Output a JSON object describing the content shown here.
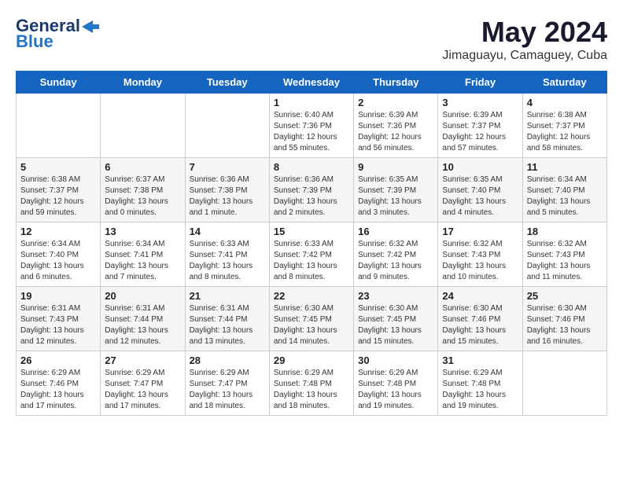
{
  "header": {
    "logo_general": "General",
    "logo_blue": "Blue",
    "month_title": "May 2024",
    "location": "Jimaguayu, Camaguey, Cuba"
  },
  "weekdays": [
    "Sunday",
    "Monday",
    "Tuesday",
    "Wednesday",
    "Thursday",
    "Friday",
    "Saturday"
  ],
  "weeks": [
    [
      {
        "day": "",
        "info": ""
      },
      {
        "day": "",
        "info": ""
      },
      {
        "day": "",
        "info": ""
      },
      {
        "day": "1",
        "info": "Sunrise: 6:40 AM\nSunset: 7:36 PM\nDaylight: 12 hours\nand 55 minutes."
      },
      {
        "day": "2",
        "info": "Sunrise: 6:39 AM\nSunset: 7:36 PM\nDaylight: 12 hours\nand 56 minutes."
      },
      {
        "day": "3",
        "info": "Sunrise: 6:39 AM\nSunset: 7:37 PM\nDaylight: 12 hours\nand 57 minutes."
      },
      {
        "day": "4",
        "info": "Sunrise: 6:38 AM\nSunset: 7:37 PM\nDaylight: 12 hours\nand 58 minutes."
      }
    ],
    [
      {
        "day": "5",
        "info": "Sunrise: 6:38 AM\nSunset: 7:37 PM\nDaylight: 12 hours\nand 59 minutes."
      },
      {
        "day": "6",
        "info": "Sunrise: 6:37 AM\nSunset: 7:38 PM\nDaylight: 13 hours\nand 0 minutes."
      },
      {
        "day": "7",
        "info": "Sunrise: 6:36 AM\nSunset: 7:38 PM\nDaylight: 13 hours\nand 1 minute."
      },
      {
        "day": "8",
        "info": "Sunrise: 6:36 AM\nSunset: 7:39 PM\nDaylight: 13 hours\nand 2 minutes."
      },
      {
        "day": "9",
        "info": "Sunrise: 6:35 AM\nSunset: 7:39 PM\nDaylight: 13 hours\nand 3 minutes."
      },
      {
        "day": "10",
        "info": "Sunrise: 6:35 AM\nSunset: 7:40 PM\nDaylight: 13 hours\nand 4 minutes."
      },
      {
        "day": "11",
        "info": "Sunrise: 6:34 AM\nSunset: 7:40 PM\nDaylight: 13 hours\nand 5 minutes."
      }
    ],
    [
      {
        "day": "12",
        "info": "Sunrise: 6:34 AM\nSunset: 7:40 PM\nDaylight: 13 hours\nand 6 minutes."
      },
      {
        "day": "13",
        "info": "Sunrise: 6:34 AM\nSunset: 7:41 PM\nDaylight: 13 hours\nand 7 minutes."
      },
      {
        "day": "14",
        "info": "Sunrise: 6:33 AM\nSunset: 7:41 PM\nDaylight: 13 hours\nand 8 minutes."
      },
      {
        "day": "15",
        "info": "Sunrise: 6:33 AM\nSunset: 7:42 PM\nDaylight: 13 hours\nand 8 minutes."
      },
      {
        "day": "16",
        "info": "Sunrise: 6:32 AM\nSunset: 7:42 PM\nDaylight: 13 hours\nand 9 minutes."
      },
      {
        "day": "17",
        "info": "Sunrise: 6:32 AM\nSunset: 7:43 PM\nDaylight: 13 hours\nand 10 minutes."
      },
      {
        "day": "18",
        "info": "Sunrise: 6:32 AM\nSunset: 7:43 PM\nDaylight: 13 hours\nand 11 minutes."
      }
    ],
    [
      {
        "day": "19",
        "info": "Sunrise: 6:31 AM\nSunset: 7:43 PM\nDaylight: 13 hours\nand 12 minutes."
      },
      {
        "day": "20",
        "info": "Sunrise: 6:31 AM\nSunset: 7:44 PM\nDaylight: 13 hours\nand 12 minutes."
      },
      {
        "day": "21",
        "info": "Sunrise: 6:31 AM\nSunset: 7:44 PM\nDaylight: 13 hours\nand 13 minutes."
      },
      {
        "day": "22",
        "info": "Sunrise: 6:30 AM\nSunset: 7:45 PM\nDaylight: 13 hours\nand 14 minutes."
      },
      {
        "day": "23",
        "info": "Sunrise: 6:30 AM\nSunset: 7:45 PM\nDaylight: 13 hours\nand 15 minutes."
      },
      {
        "day": "24",
        "info": "Sunrise: 6:30 AM\nSunset: 7:46 PM\nDaylight: 13 hours\nand 15 minutes."
      },
      {
        "day": "25",
        "info": "Sunrise: 6:30 AM\nSunset: 7:46 PM\nDaylight: 13 hours\nand 16 minutes."
      }
    ],
    [
      {
        "day": "26",
        "info": "Sunrise: 6:29 AM\nSunset: 7:46 PM\nDaylight: 13 hours\nand 17 minutes."
      },
      {
        "day": "27",
        "info": "Sunrise: 6:29 AM\nSunset: 7:47 PM\nDaylight: 13 hours\nand 17 minutes."
      },
      {
        "day": "28",
        "info": "Sunrise: 6:29 AM\nSunset: 7:47 PM\nDaylight: 13 hours\nand 18 minutes."
      },
      {
        "day": "29",
        "info": "Sunrise: 6:29 AM\nSunset: 7:48 PM\nDaylight: 13 hours\nand 18 minutes."
      },
      {
        "day": "30",
        "info": "Sunrise: 6:29 AM\nSunset: 7:48 PM\nDaylight: 13 hours\nand 19 minutes."
      },
      {
        "day": "31",
        "info": "Sunrise: 6:29 AM\nSunset: 7:48 PM\nDaylight: 13 hours\nand 19 minutes."
      },
      {
        "day": "",
        "info": ""
      }
    ]
  ]
}
